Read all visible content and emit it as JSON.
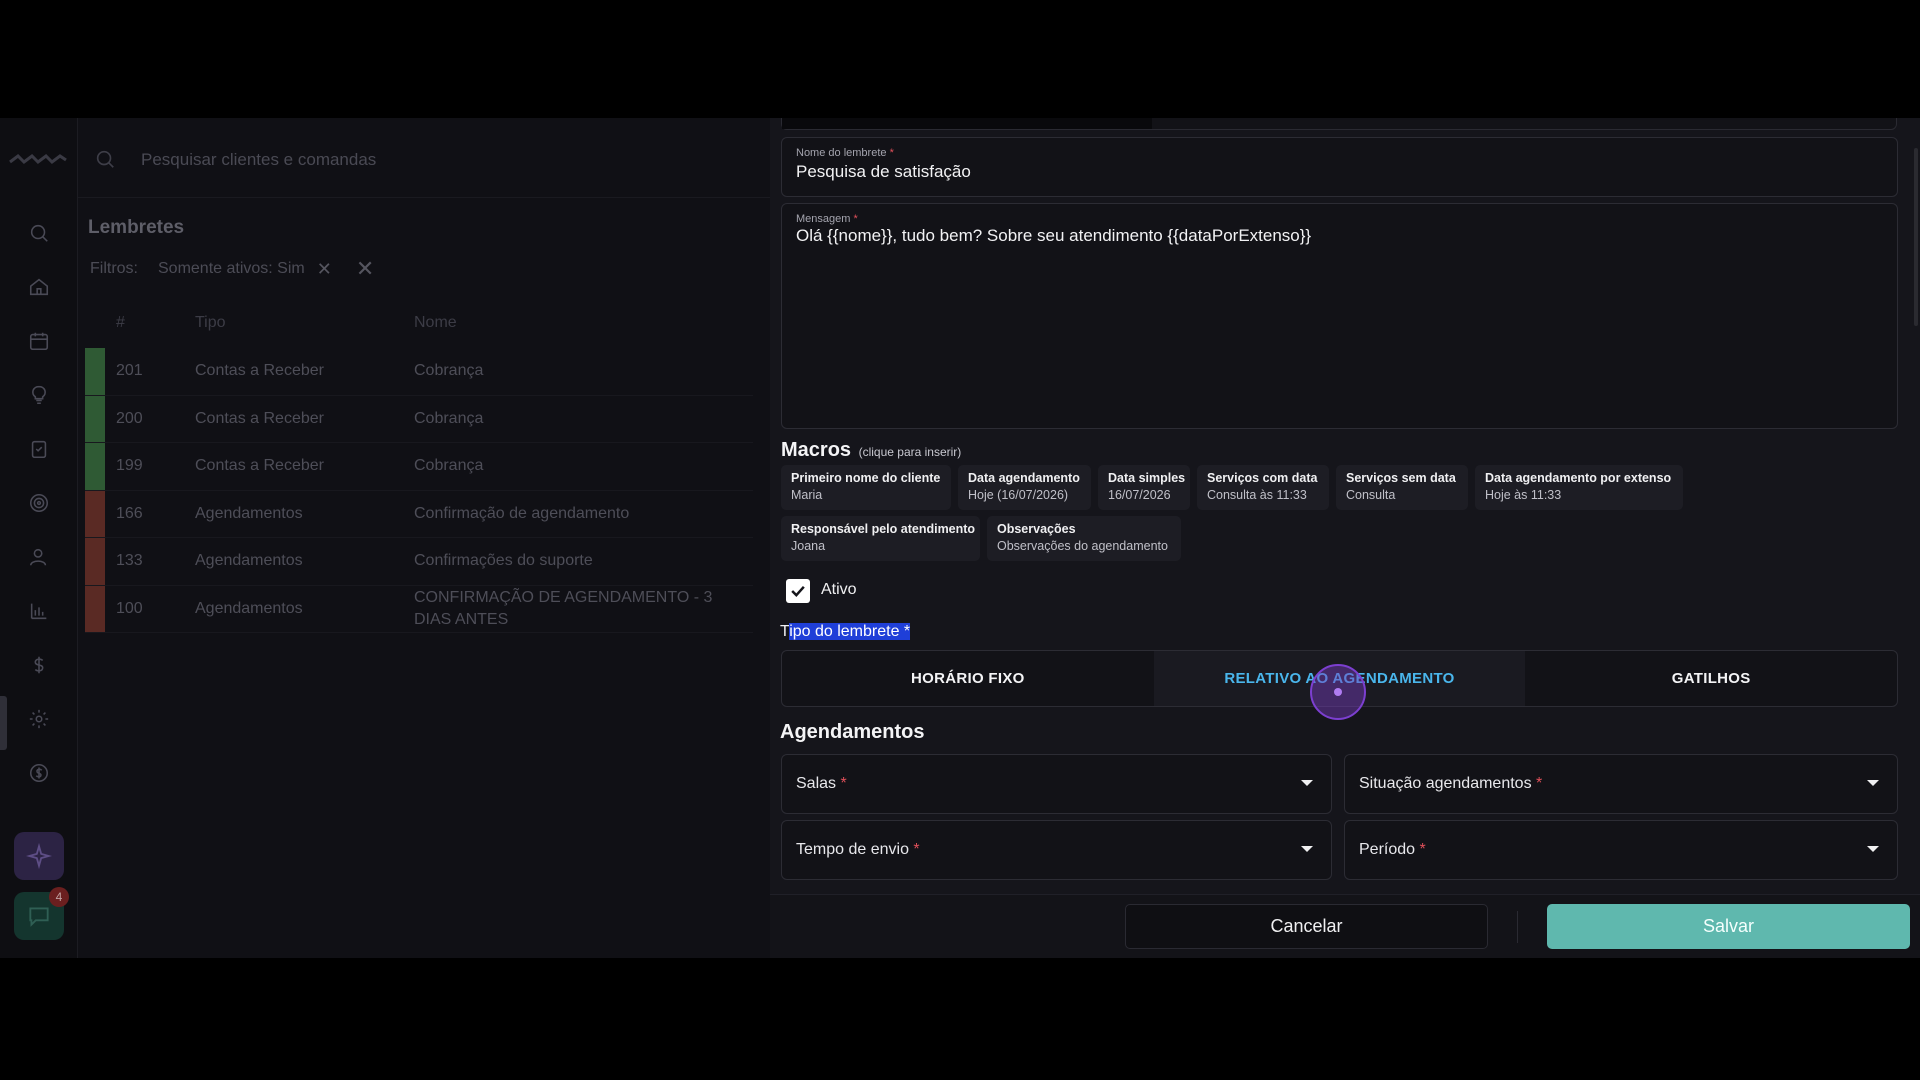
{
  "search": {
    "placeholder": "Pesquisar clientes e comandas"
  },
  "list": {
    "title": "Lembretes",
    "filters_label": "Filtros:",
    "filter_chip": "Somente ativos: Sim",
    "columns": [
      "#",
      "Tipo",
      "Nome"
    ],
    "rows": [
      {
        "id": "201",
        "tipo": "Contas a Receber",
        "nome": "Cobrança",
        "color": "#2f5a34"
      },
      {
        "id": "200",
        "tipo": "Contas a Receber",
        "nome": "Cobrança",
        "color": "#2f5a34"
      },
      {
        "id": "199",
        "tipo": "Contas a Receber",
        "nome": "Cobrança",
        "color": "#2f5a34"
      },
      {
        "id": "166",
        "tipo": "Agendamentos",
        "nome": "Confirmação de agendamento",
        "color": "#5a2a24"
      },
      {
        "id": "133",
        "tipo": "Agendamentos",
        "nome": "Confirmações do suporte",
        "color": "#5a2a24"
      },
      {
        "id": "100",
        "tipo": "Agendamentos",
        "nome": "CONFIRMAÇÃO DE AGENDAMENTO - 3 DIAS ANTES",
        "color": "#5a2a24"
      }
    ]
  },
  "chat_badge": "4",
  "form": {
    "nome_label": "Nome do lembrete",
    "nome_value": "Pesquisa de satisfação",
    "mensagem_label": "Mensagem",
    "mensagem_value": "Olá {{nome}}, tudo bem? Sobre seu atendimento {{dataPorExtenso}}",
    "macros_title": "Macros",
    "macros_hint": "(clique para inserir)",
    "macros": [
      {
        "title": "Primeiro nome do cliente",
        "value": "Maria"
      },
      {
        "title": "Data agendamento",
        "value": "Hoje (16/07/2026)"
      },
      {
        "title": "Data simples",
        "value": "16/07/2026"
      },
      {
        "title": "Serviços com data",
        "value": "Consulta às 11:33"
      },
      {
        "title": "Serviços sem data",
        "value": "Consulta"
      },
      {
        "title": "Data agendamento por extenso",
        "value": "Hoje às 11:33"
      },
      {
        "title": "Responsável pelo atendimento",
        "value": "Joana"
      },
      {
        "title": "Observações",
        "value": "Observações do agendamento"
      }
    ],
    "ativo_label": "Ativo",
    "ativo_checked": true,
    "tipo_label_first": "T",
    "tipo_label_selected": "ipo do lembrete *",
    "tipo_options": [
      "HORÁRIO FIXO",
      "RELATIVO AO AGENDAMENTO",
      "GATILHOS"
    ],
    "tipo_selected": "RELATIVO AO AGENDAMENTO",
    "agendamentos_title": "Agendamentos",
    "selects": {
      "salas": "Salas",
      "situacao": "Situação agendamentos",
      "tempo": "Tempo de envio",
      "periodo": "Período"
    },
    "required_mark": "*"
  },
  "footer": {
    "cancel": "Cancelar",
    "save": "Salvar"
  },
  "colors": {
    "accent": "#4ab6ec",
    "save": "#5fb8ae",
    "required": "#e0505a"
  }
}
